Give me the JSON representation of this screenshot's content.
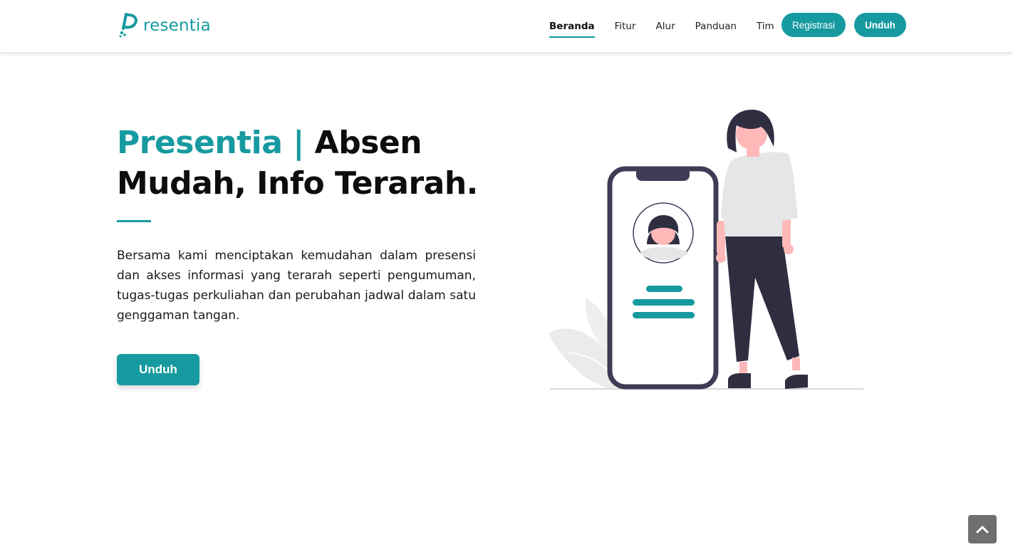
{
  "brand": {
    "logo_text": "resentia",
    "accent_color": "#169aa0"
  },
  "nav": {
    "items": [
      {
        "label": "Beranda",
        "active": true
      },
      {
        "label": "Fitur",
        "active": false
      },
      {
        "label": "Alur",
        "active": false
      },
      {
        "label": "Panduan",
        "active": false
      },
      {
        "label": "Tim",
        "active": false
      }
    ],
    "register_label": "Registrasi",
    "download_label": "Unduh"
  },
  "hero": {
    "title_brand": "Presentia |",
    "title_rest": "Absen Mudah, Info Terarah.",
    "description": "Bersama kami menciptakan kemudahan dalam presensi dan akses informasi yang terarah seperti pengumuman, tugas-tugas perkuliahan dan perubahan jadwal dalam satu genggaman tangan.",
    "cta_label": "Unduh"
  },
  "icons": {
    "scroll_top": "chevron-up-icon"
  }
}
